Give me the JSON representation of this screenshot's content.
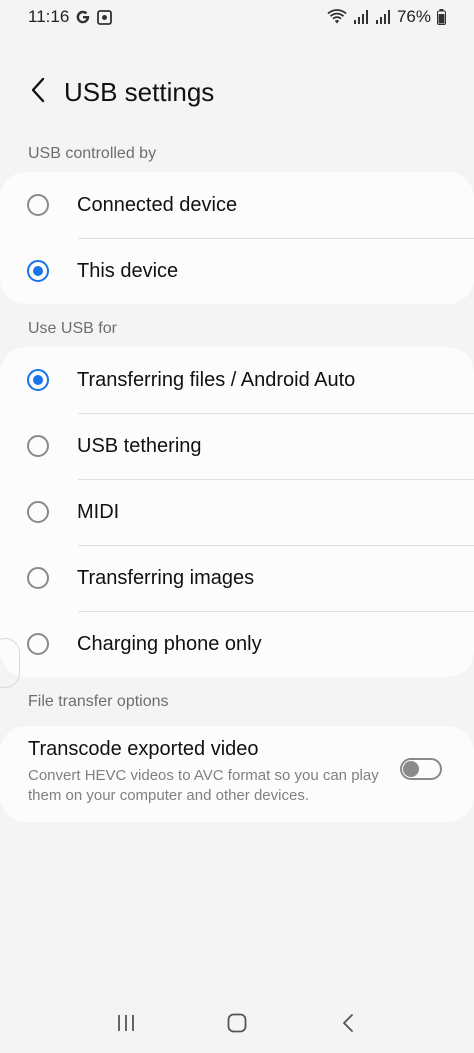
{
  "status_bar": {
    "time": "11:16",
    "left_icons": [
      "google-icon",
      "photo-icon"
    ],
    "right_icons": [
      "wifi-icon",
      "signal-icon",
      "signal-icon"
    ],
    "battery": "76%"
  },
  "header": {
    "title": "USB settings",
    "back_icon": "chevron-left-icon"
  },
  "usb_controlled_by": {
    "label": "USB controlled by",
    "options": [
      {
        "label": "Connected device",
        "selected": false
      },
      {
        "label": "This device",
        "selected": true
      }
    ]
  },
  "use_usb_for": {
    "label": "Use USB for",
    "options": [
      {
        "label": "Transferring files / Android Auto",
        "selected": true
      },
      {
        "label": "USB tethering",
        "selected": false
      },
      {
        "label": "MIDI",
        "selected": false
      },
      {
        "label": "Transferring images",
        "selected": false
      },
      {
        "label": "Charging phone only",
        "selected": false
      }
    ]
  },
  "file_transfer": {
    "label": "File transfer options",
    "title": "Transcode exported video",
    "description": "Convert HEVC videos to AVC format so you can play them on your computer and other devices.",
    "enabled": false
  },
  "nav_bar": {
    "icons": [
      "recent-apps-icon",
      "home-icon",
      "back-icon"
    ]
  },
  "colors": {
    "accent": "#1a73e8",
    "background": "#f4f4f4",
    "card": "#fcfcfc"
  }
}
